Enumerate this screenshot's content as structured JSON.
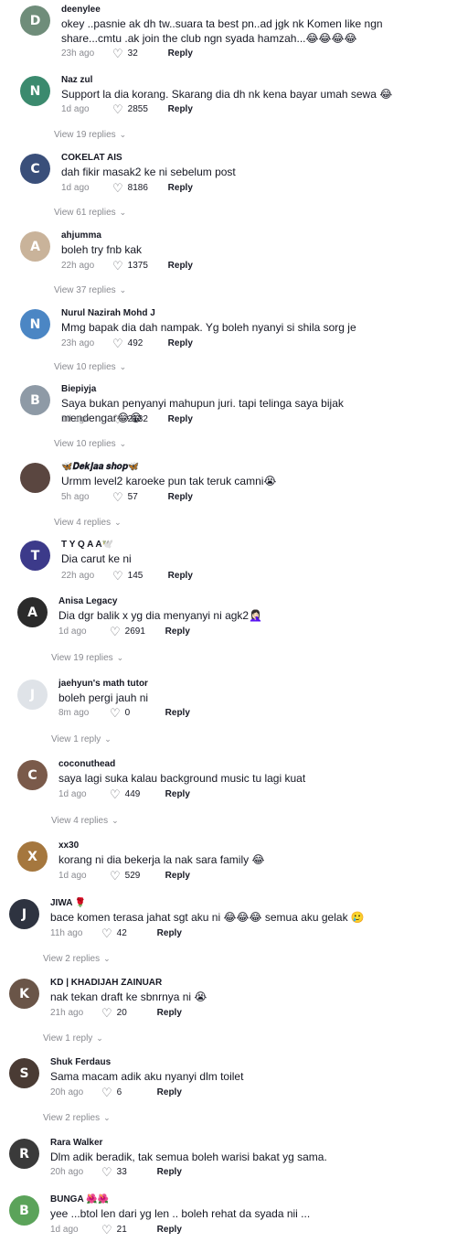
{
  "comments": [
    {
      "user": "deenylee",
      "text": "okey ..pasnie ak dh tw..suara ta best pn..ad jgk nk Komen like ngn share...cmtu .ak join the club ngn syada hamzah...😂😂😂😂",
      "time": "23h ago",
      "likes": "32",
      "reply": "Reply",
      "replies": "",
      "avatar_color": "#6f8d7a"
    },
    {
      "user": "Naz zul",
      "text": "Support la dia korang. Skarang dia dh nk kena bayar umah sewa 😂",
      "time": "1d ago",
      "likes": "2855",
      "reply": "Reply",
      "replies": "View 19 replies",
      "avatar_color": "#3b8a6e"
    },
    {
      "user": "COKELAT AIS",
      "text": "dah fikir masak2 ke ni sebelum post",
      "time": "1d ago",
      "likes": "8186",
      "reply": "Reply",
      "replies": "View 61 replies",
      "avatar_color": "#3a4f7a"
    },
    {
      "user": "ahjumma",
      "text": "boleh try fnb kak",
      "time": "22h ago",
      "likes": "1375",
      "reply": "Reply",
      "replies": "View 37 replies",
      "avatar_color": "#c9b39a"
    },
    {
      "user": "Nurul Nazirah Mohd J",
      "text": "Mmg bapak dia dah nampak. Yg boleh nyanyi si shila sorg je",
      "time": "23h ago",
      "likes": "492",
      "reply": "Reply",
      "replies": "View 10 replies",
      "avatar_color": "#4b86c4"
    },
    {
      "user": "Biepiyja",
      "text": "Saya bukan penyanyi mahupun juri. tapi telinga saya bijak mendengar😂😂",
      "time": "1d ago",
      "likes": "2132",
      "reply": "Reply",
      "replies": "View 10 replies",
      "avatar_color": "#8e9aa6"
    },
    {
      "user": "🦋𝑫𝒆𝒌𝒋𝒂𝒂 𝒔𝒉𝒐𝒑🦋",
      "text": "Urmm level2 karoeke pun tak teruk camni😭",
      "time": "5h ago",
      "likes": "57",
      "reply": "Reply",
      "replies": "View 4 replies",
      "avatar_color": "#5a4640"
    },
    {
      "user": "T Y Q A A🕊️",
      "text": "Dia carut ke ni",
      "time": "22h ago",
      "likes": "145",
      "reply": "Reply",
      "replies": "",
      "avatar_color": "#3c3a8a"
    },
    {
      "user": "Anisa Legacy",
      "text": "Dia dgr balik x yg dia menyanyi ni agk2🤦🏻‍♀️",
      "time": "1d ago",
      "likes": "2691",
      "reply": "Reply",
      "replies": "View 19 replies",
      "avatar_color": "#2b2b2b"
    },
    {
      "user": "jaehyun's math tutor",
      "text": "boleh pergi jauh ni",
      "time": "8m ago",
      "likes": "0",
      "reply": "Reply",
      "replies": "View 1 reply",
      "avatar_color": "#dfe3e8"
    },
    {
      "user": "coconuthead",
      "text": "saya lagi suka kalau background music tu lagi kuat",
      "time": "1d ago",
      "likes": "449",
      "reply": "Reply",
      "replies": "View 4 replies",
      "avatar_color": "#7a5a4a"
    },
    {
      "user": "xx30",
      "text": "korang ni dia bekerja la nak sara family 😂",
      "time": "1d ago",
      "likes": "529",
      "reply": "Reply",
      "replies": "",
      "avatar_color": "#a5773e"
    },
    {
      "user": "JIWA 🌹",
      "text": "bace komen terasa jahat sgt aku ni 😂😂😂 semua aku gelak 🥲",
      "time": "11h ago",
      "likes": "42",
      "reply": "Reply",
      "replies": "View 2 replies",
      "avatar_color": "#2e3340"
    },
    {
      "user": "KD | KHADIJAH ZAINUAR",
      "text": "nak tekan draft ke sbnrnya ni 😭",
      "time": "21h ago",
      "likes": "20",
      "reply": "Reply",
      "replies": "View 1 reply",
      "avatar_color": "#6a5548"
    },
    {
      "user": "Shuk Ferdaus",
      "text": "Sama macam adik aku nyanyi dlm toilet",
      "time": "20h ago",
      "likes": "6",
      "reply": "Reply",
      "replies": "View 2 replies",
      "avatar_color": "#4a3b34"
    },
    {
      "user": "Rara Walker",
      "text": "Dlm adik beradik, tak semua boleh warisi bakat yg sama.",
      "time": "20h ago",
      "likes": "33",
      "reply": "Reply",
      "replies": "",
      "avatar_color": "#3a3a3a"
    },
    {
      "user": "BUNGA 🌺🌺",
      "text": "yee ...btol len dari yg len .. boleh rehat da syada nii ...",
      "time": "1d ago",
      "likes": "21",
      "reply": "Reply",
      "replies": "",
      "avatar_color": "#5ba35a"
    }
  ]
}
